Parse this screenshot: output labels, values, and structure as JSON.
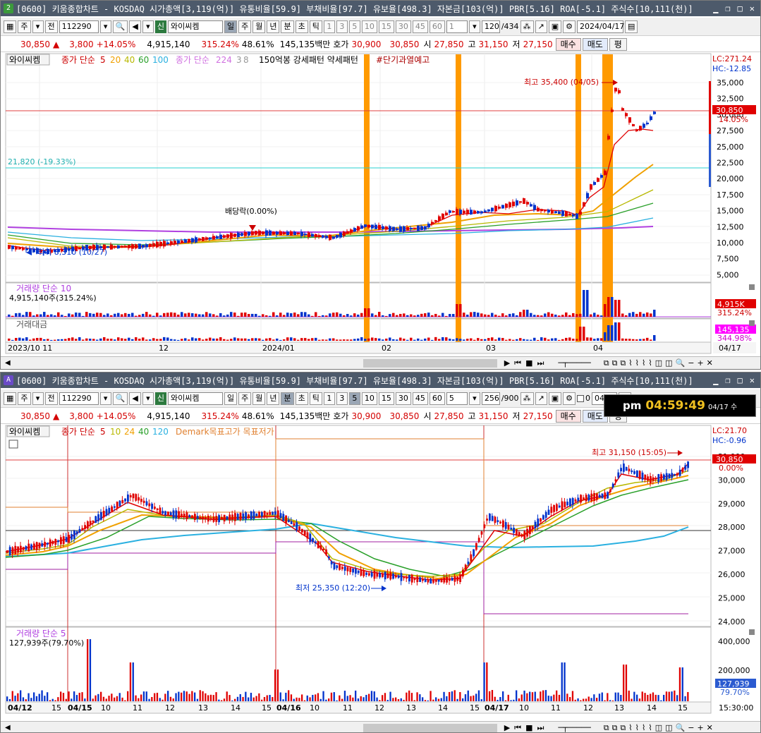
{
  "windows": [
    {
      "badge": "2",
      "title": "[0600] 키움종합차트 - KOSDAQ 시가총액[3,119(억)] 유통비율[59.9] 부채비율[97.7] 유보율[498.3] 자본금[103(억)] PBR[5.16] ROA[-5.1] 주식수[10,111(천)]",
      "toolbar": {
        "mode": "주",
        "type": "전",
        "code": "112290",
        "name_btn": "신",
        "name": "와이씨켐",
        "periods": [
          "일",
          "주",
          "월",
          "년",
          "분",
          "초",
          "틱"
        ],
        "selected_period": "일",
        "nums": [
          "1",
          "3",
          "5",
          "10",
          "15",
          "30",
          "45",
          "60"
        ],
        "num_select": "1",
        "count": "120",
        "total": "/434",
        "date": "2024/04/17"
      },
      "quote": {
        "price": "30,850",
        "arrow": "▲",
        "change": "3,800",
        "pct": "+14.05%",
        "volume": "4,915,140",
        "vol_pct": "315.24%",
        "turnover": "48.61%",
        "amount": "145,135백만",
        "hoga_label": "호가",
        "bid": "30,900",
        "ask": "30,850",
        "open_label": "시",
        "open": "27,850",
        "high_label": "고",
        "high": "31,150",
        "low_label": "저",
        "low": "27,150",
        "buy": "매수",
        "sell": "매도",
        "eval": "평"
      },
      "legend": {
        "stock": "와이씨켐",
        "ma_label": "종가 단순",
        "ma_periods": [
          "5",
          "20",
          "40",
          "60",
          "100"
        ],
        "ma2_label": "종가 단순",
        "ma2_periods": [
          "224",
          "3",
          "8"
        ],
        "extra": "150억봉 강세패턴  약세패턴",
        "alert": "#단기과열예고"
      },
      "annotations": {
        "high": "최고 35,400 (04/05)",
        "low": "최저 8,310 (10/27)",
        "dividend": "배당락(0.00%)",
        "hline_label": "21,820 (-19.33%)",
        "lc": "LC:271.24",
        "hc": "HC:-12.85",
        "price_tag": "30,850",
        "pct_tag": "14.05%"
      },
      "y_ticks": [
        "35,000",
        "32,500",
        "30,000",
        "27,500",
        "25,000",
        "22,500",
        "20,000",
        "17,500",
        "15,000",
        "12,500",
        "10,000",
        "7,500",
        "5,000"
      ],
      "volume_panel": {
        "label": "거래량 단순 10",
        "value": "4,915,140주(315.24%)",
        "tag": "4,915K",
        "tag2": "315.24%"
      },
      "amount_panel": {
        "label": "거래대금",
        "tag": "145,135",
        "tag2": "344.98%"
      },
      "x_ticks": [
        "2023/10",
        "11",
        "12",
        "2024/01",
        "02",
        "03",
        "04"
      ],
      "x_current": "04/17"
    },
    {
      "badge": "A",
      "title": "[0600] 키움종합차트 - KOSDAQ 시가총액[3,119(억)] 유통비율[59.9] 부채비율[97.7] 유보율[498.3] 자본금[103(억)] PBR[5.16] ROA[-5.1] 주식수[10,111(천)]",
      "toolbar": {
        "mode": "주",
        "type": "전",
        "code": "112290",
        "name_btn": "신",
        "name": "와이씨켐",
        "periods": [
          "일",
          "주",
          "월",
          "년",
          "분",
          "초",
          "틱"
        ],
        "selected_period": "분",
        "nums": [
          "1",
          "3",
          "5",
          "10",
          "15",
          "30",
          "45",
          "60"
        ],
        "selected_num": "5",
        "num_select": "5",
        "count": "256",
        "total": "/900",
        "check_label": "0",
        "date": "04/17"
      },
      "quote": {
        "price": "30,850",
        "arrow": "▲",
        "change": "3,800",
        "pct": "+14.05%",
        "volume": "4,915,140",
        "vol_pct": "315.24%",
        "turnover": "48.61%",
        "amount": "145,135백만",
        "hoga_label": "호가",
        "bid": "30,900",
        "ask": "30,850",
        "open_label": "시",
        "open": "27,850",
        "high_label": "고",
        "high": "31,150",
        "low_label": "저",
        "low": "27,150",
        "buy": "매수",
        "sell": "매도",
        "eval": "평"
      },
      "legend": {
        "stock": "와이씨켐",
        "ma_label": "종가 단순",
        "ma_periods": [
          "5",
          "10",
          "24",
          "40",
          "120"
        ],
        "demark": "Demark목표고가  목표저가"
      },
      "annotations": {
        "high": "최고 31,150 (15:05)",
        "low": "최저 25,350 (12:20)",
        "lc": "LC:21.70",
        "hc": "HC:-0.96",
        "price_tag": "30,850",
        "pct_tag": "0.00%"
      },
      "y_ticks": [
        "31,000",
        "30,000",
        "29,000",
        "28,000",
        "27,000",
        "26,000",
        "25,000",
        "24,000"
      ],
      "volume_panel": {
        "label": "거래량 단순 5",
        "value": "127,939주(79.70%)",
        "tag": "127,939",
        "tag2": "79.70%",
        "ticks": [
          "400,000",
          "200,000"
        ]
      },
      "x_ticks": [
        "04/12",
        "15",
        "04/15",
        "10",
        "11",
        "12",
        "13",
        "14",
        "15",
        "04/16",
        "10",
        "11",
        "12",
        "13",
        "14",
        "15",
        "04/17",
        "10",
        "11",
        "12",
        "13",
        "14",
        "15"
      ],
      "x_current": "15:30:00"
    }
  ],
  "clock": {
    "ampm": "pm",
    "time": "04:59:49",
    "date": "04/17 수"
  },
  "colors": {
    "up": "#e00000",
    "down": "#0033cc",
    "signal": "#ff9900",
    "ma5": "#e00000",
    "ma20": "#f0a000",
    "ma40": "#b8b800",
    "ma60": "#2aa02a",
    "ma100": "#2ab0e0",
    "ma224": "#b040e0"
  }
}
